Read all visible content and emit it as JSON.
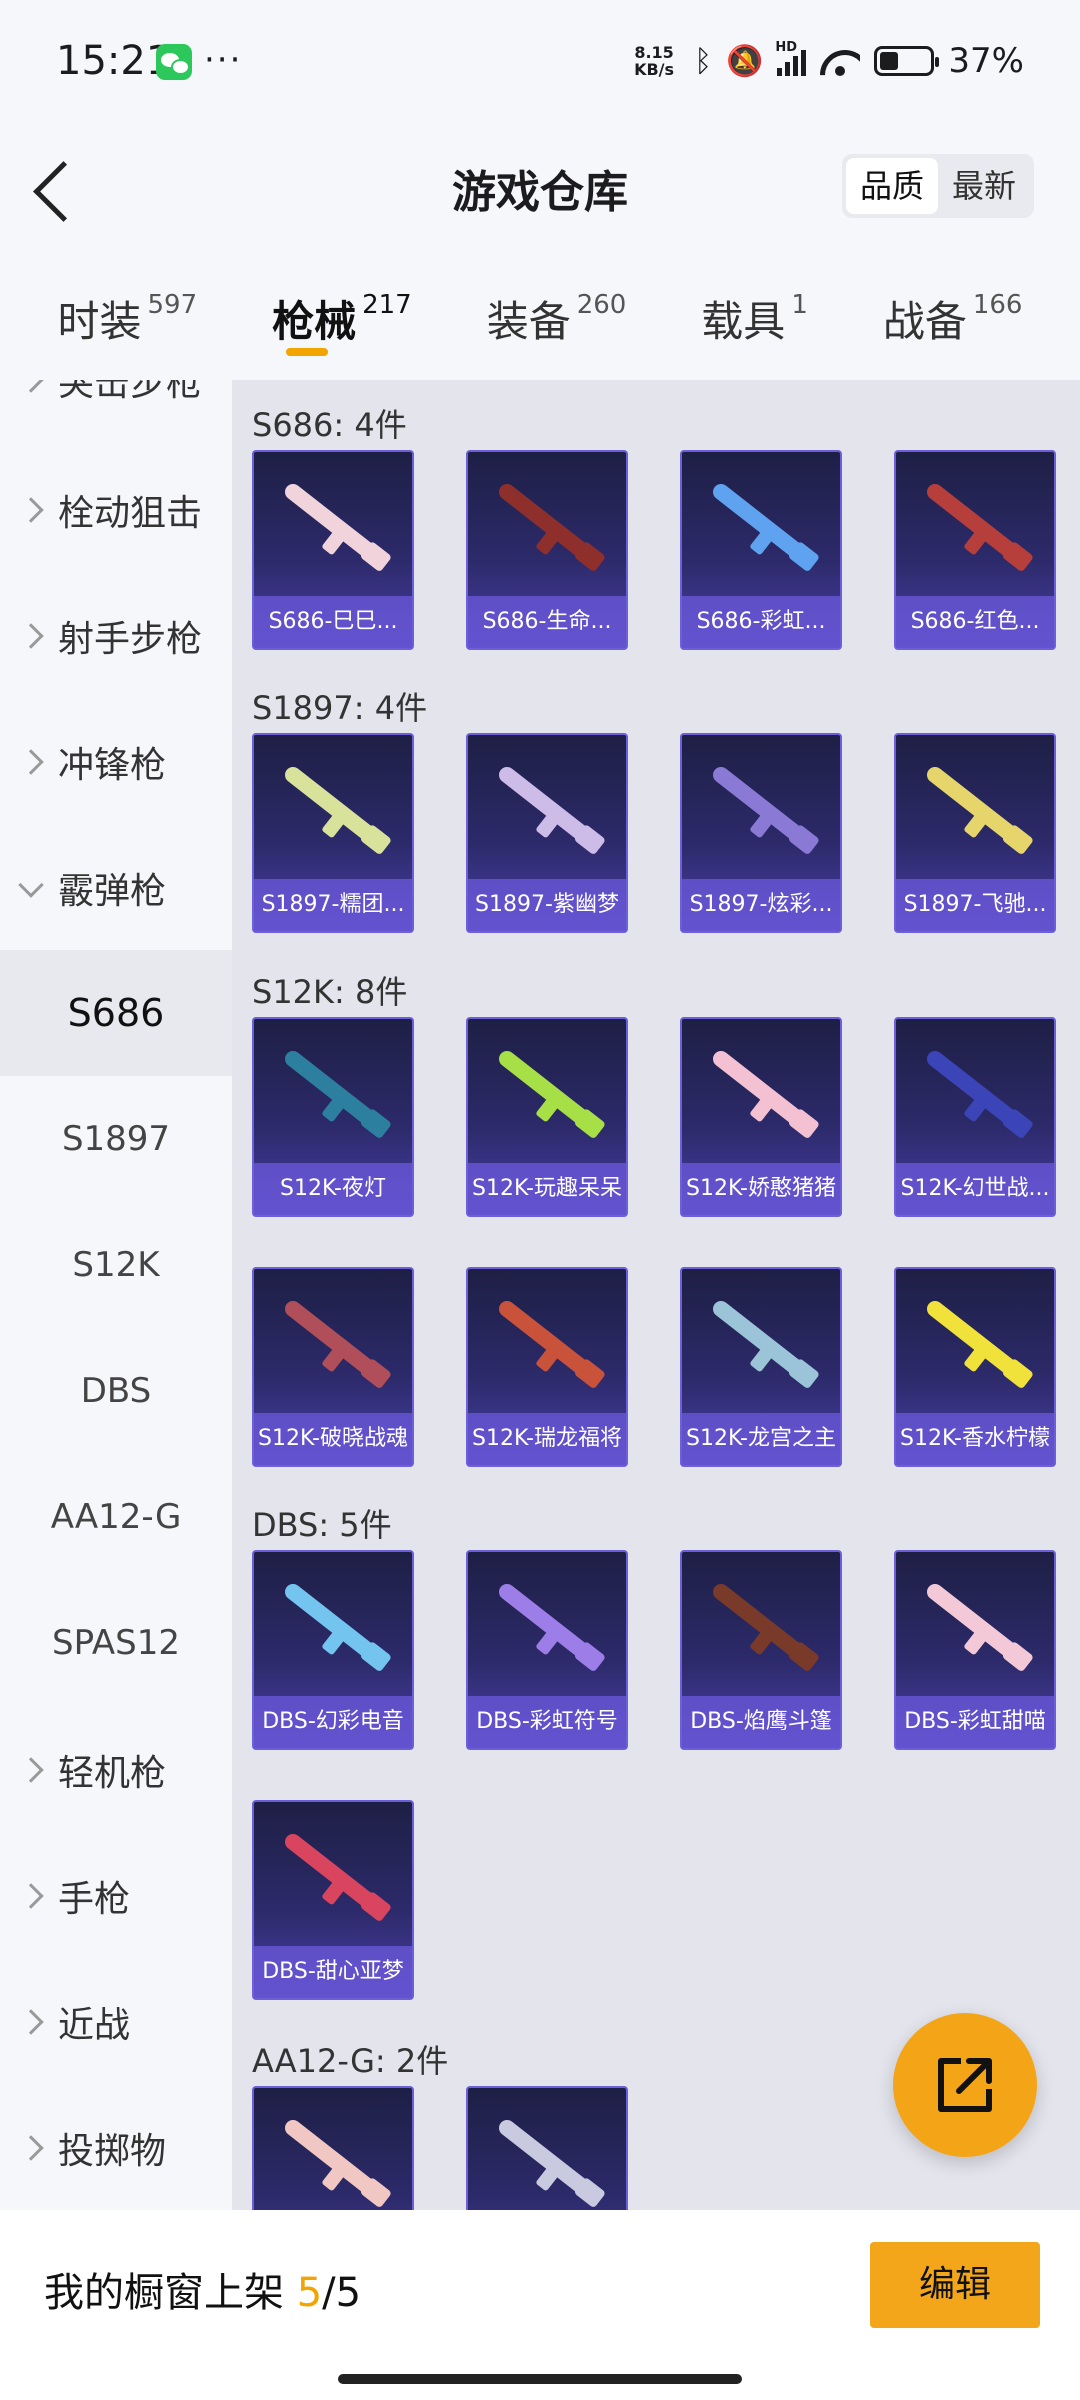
{
  "status_bar": {
    "time": "15:21",
    "net_speed_value": "8.15",
    "net_speed_unit": "KB/s",
    "network": "HD",
    "battery": "37%",
    "battery_level": 0.37,
    "more": "···"
  },
  "header": {
    "title": "游戏仓库",
    "sort_quality": "品质",
    "sort_latest": "最新"
  },
  "tabs": [
    {
      "label": "时装",
      "count": "597"
    },
    {
      "label": "枪械",
      "count": "217"
    },
    {
      "label": "装备",
      "count": "260"
    },
    {
      "label": "载具",
      "count": "1"
    },
    {
      "label": "战备",
      "count": "166"
    }
  ],
  "sidebar": {
    "partial_top": "突击步枪",
    "categories": [
      "栓动狙击",
      "射手步枪",
      "冲锋枪",
      "霰弹枪"
    ],
    "subcategories": [
      "S686",
      "S1897",
      "S12K",
      "DBS",
      "AA12-G",
      "SPAS12"
    ],
    "categories_bottom": [
      "轻机枪",
      "手枪",
      "近战",
      "投掷物"
    ]
  },
  "sections": [
    {
      "title": "S686: 4件",
      "items": [
        "S686-巳巳...",
        "S686-生命...",
        "S686-彩虹...",
        "S686-红色..."
      ]
    },
    {
      "title": "S1897: 4件",
      "items": [
        "S1897-糯团...",
        "S1897-紫幽梦",
        "S1897-炫彩...",
        "S1897-飞驰..."
      ]
    },
    {
      "title": "S12K: 8件",
      "items": [
        "S12K-夜灯",
        "S12K-玩趣呆呆",
        "S12K-娇憨猪猪",
        "S12K-幻世战...",
        "S12K-破晓战魂",
        "S12K-瑞龙福将",
        "S12K-龙宫之主",
        "S12K-香水柠檬"
      ]
    },
    {
      "title": "DBS: 5件",
      "items": [
        "DBS-幻彩电音",
        "DBS-彩虹符号",
        "DBS-焰鹰斗篷",
        "DBS-彩虹甜喵",
        "DBS-甜心亚梦"
      ]
    },
    {
      "title": "AA12-G: 2件",
      "items": [
        "",
        ""
      ]
    }
  ],
  "bottom_bar": {
    "showcase_label": "我的橱窗上架",
    "showcase_count": "5",
    "showcase_total": "/5",
    "edit_label": "编辑"
  },
  "colors": {
    "accent": "#f4a61a",
    "card_border": "#6d5fd9"
  }
}
